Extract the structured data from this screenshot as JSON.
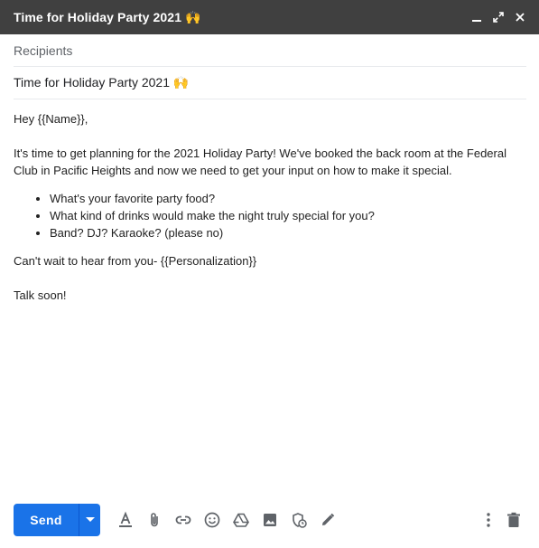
{
  "window": {
    "title": "Time for Holiday Party 2021 🙌",
    "icons": [
      "minimize-icon",
      "expand-icon",
      "close-icon"
    ]
  },
  "compose": {
    "recipients_placeholder": "Recipients",
    "subject": "Time for Holiday Party 2021 🙌"
  },
  "message": {
    "greeting": "Hey {{Name}},",
    "paragraph": "It's time to get planning for the 2021 Holiday Party! We've booked the back room at the Federal Club in Pacific Heights and now we need to get your input on how to make it special.",
    "bullets": [
      "What's your favorite party food?",
      "What kind of drinks would make the night truly special for you?",
      "Band? DJ? Karaoke? (please no)"
    ],
    "closing": "Can't wait to hear from you- {{Personalization}}",
    "signoff": "Talk soon!"
  },
  "toolbar": {
    "send_label": "Send",
    "icons": [
      "formatting-icon",
      "attach-icon",
      "link-icon",
      "emoji-icon",
      "drive-icon",
      "photo-icon",
      "confidential-icon",
      "signature-icon"
    ],
    "right_icons": [
      "more-options-icon",
      "trash-icon"
    ]
  },
  "colors": {
    "titlebar": "#404040",
    "send": "#1a73e8",
    "icon": "#5f6368"
  }
}
